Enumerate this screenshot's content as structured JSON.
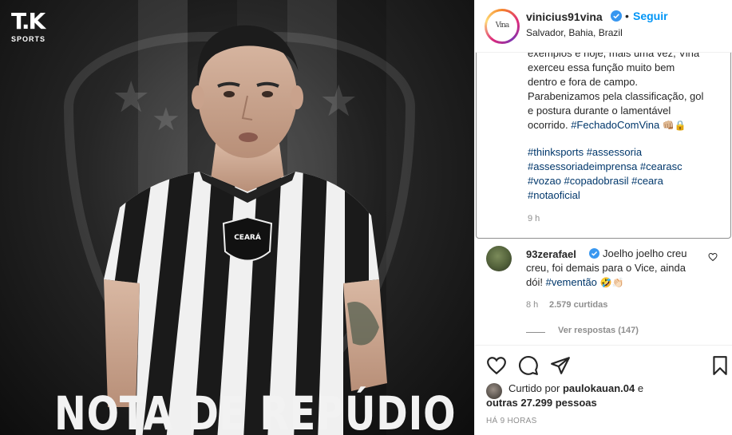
{
  "image": {
    "brand_logo": "T.K",
    "brand_sub": "SPORTS",
    "headline": "NOTA DE REPÚDIO",
    "jersey_badge": "CEARÁ"
  },
  "header": {
    "avatar_text": "Vina",
    "username": "vinicius91vina",
    "follow_label": "Seguir",
    "separator": "•",
    "location": "Salvador, Bahia, Brazil"
  },
  "caption": {
    "lines": [
      "exemplos e hoje, mais uma vez, Vina",
      "exerceu essa função muito bem",
      "dentro e fora de campo.",
      "Parabenizamos pela classificação, gol",
      "e postura durante o lamentável",
      "ocorrido."
    ],
    "hashtag_fechado": "#FechadoComVina",
    "emojis_1": "👊🏼🔒",
    "hashtags": [
      "#thinksports #assessoria",
      "#assessoriadeimprensa #cearasc",
      "#vozao #copadobrasil #ceara",
      "#notaoficial"
    ],
    "time": "9 h"
  },
  "comment": {
    "username": "93zerafael",
    "text_1": "Joelho joelho creu",
    "text_2": "creu, foi demais para o Vice, ainda",
    "text_3_plain": "dói!",
    "text_3_hashtag": "#vementão",
    "emojis": "🤣👏🏻",
    "time": "8 h",
    "likes": "2.579 curtidas",
    "replies": "Ver respostas (147)"
  },
  "actions": {
    "like_icon": "heart-icon",
    "comment_icon": "comment-bubble-icon",
    "share_icon": "paper-plane-icon",
    "save_icon": "bookmark-icon"
  },
  "likes": {
    "prefix": "Curtido por",
    "user": "paulokauan.04",
    "conj": "e",
    "others": "outras 27.299 pessoas"
  },
  "timestamp": "HÁ 9 HORAS",
  "colors": {
    "link_blue": "#0095f6",
    "hashtag_blue": "#00376b",
    "verified_blue": "#3897f0",
    "muted_gray": "#8e8e8e"
  }
}
